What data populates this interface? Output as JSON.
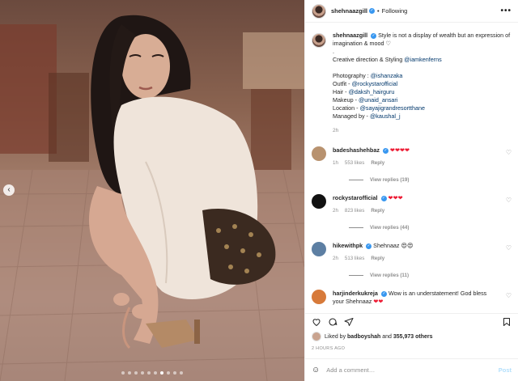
{
  "photo": {
    "alt_icon": "post-photo",
    "carousel_total": 10,
    "carousel_active_index": 6
  },
  "header": {
    "username": "shehnaazgill",
    "separator": "•",
    "follow_state": "Following",
    "more": "•••"
  },
  "caption": {
    "username": "shehnaazgill",
    "lines": [
      "Style is not a display of wealth but an expression of imagination & mood ♡",
      ".",
      "Creative direction & Styling @iamkenferns",
      "",
      "Photography : @ishanzaka",
      "Outfit - @rockystarofficial",
      "Hair - @daksh_hairguru",
      "Makeup - @unaid_ansari",
      "Location - @sayajigrandresortthane",
      "Managed by - @kaushal_j"
    ],
    "time": "2h"
  },
  "comments": [
    {
      "username": "badeshashehbaz",
      "text": "❤❤❤❤",
      "time": "1h",
      "likes": "553 likes",
      "reply": "Reply",
      "view_replies": "View replies (19)",
      "avatar_color": "#b8926f"
    },
    {
      "username": "rockystarofficial",
      "text": "❤❤❤",
      "time": "2h",
      "likes": "823 likes",
      "reply": "Reply",
      "view_replies": "View replies (44)",
      "avatar_color": "#111111"
    },
    {
      "username": "hikewithpk",
      "text": "Shehnaaz 😍😍",
      "time": "2h",
      "likes": "513 likes",
      "reply": "Reply",
      "view_replies": "View replies (11)",
      "avatar_color": "#5d7fa3"
    },
    {
      "username": "harjinderkukreja",
      "text": "Wow is an understatement! God bless your Shehnaaz ❤❤",
      "time": "",
      "likes": "",
      "reply": "",
      "view_replies": "",
      "avatar_color": "#d77a3a"
    }
  ],
  "likes": {
    "prefix": "Liked by",
    "user": "badboyshah",
    "joiner": "and",
    "count": "355,973 others"
  },
  "post_time": "2 HOURS AGO",
  "add_comment": {
    "placeholder": "Add a comment…",
    "post_label": "Post"
  },
  "colors": {
    "link": "#00376b",
    "verified": "#3897f0",
    "heart": "#ed1b34",
    "muted": "#8e8e8e"
  }
}
